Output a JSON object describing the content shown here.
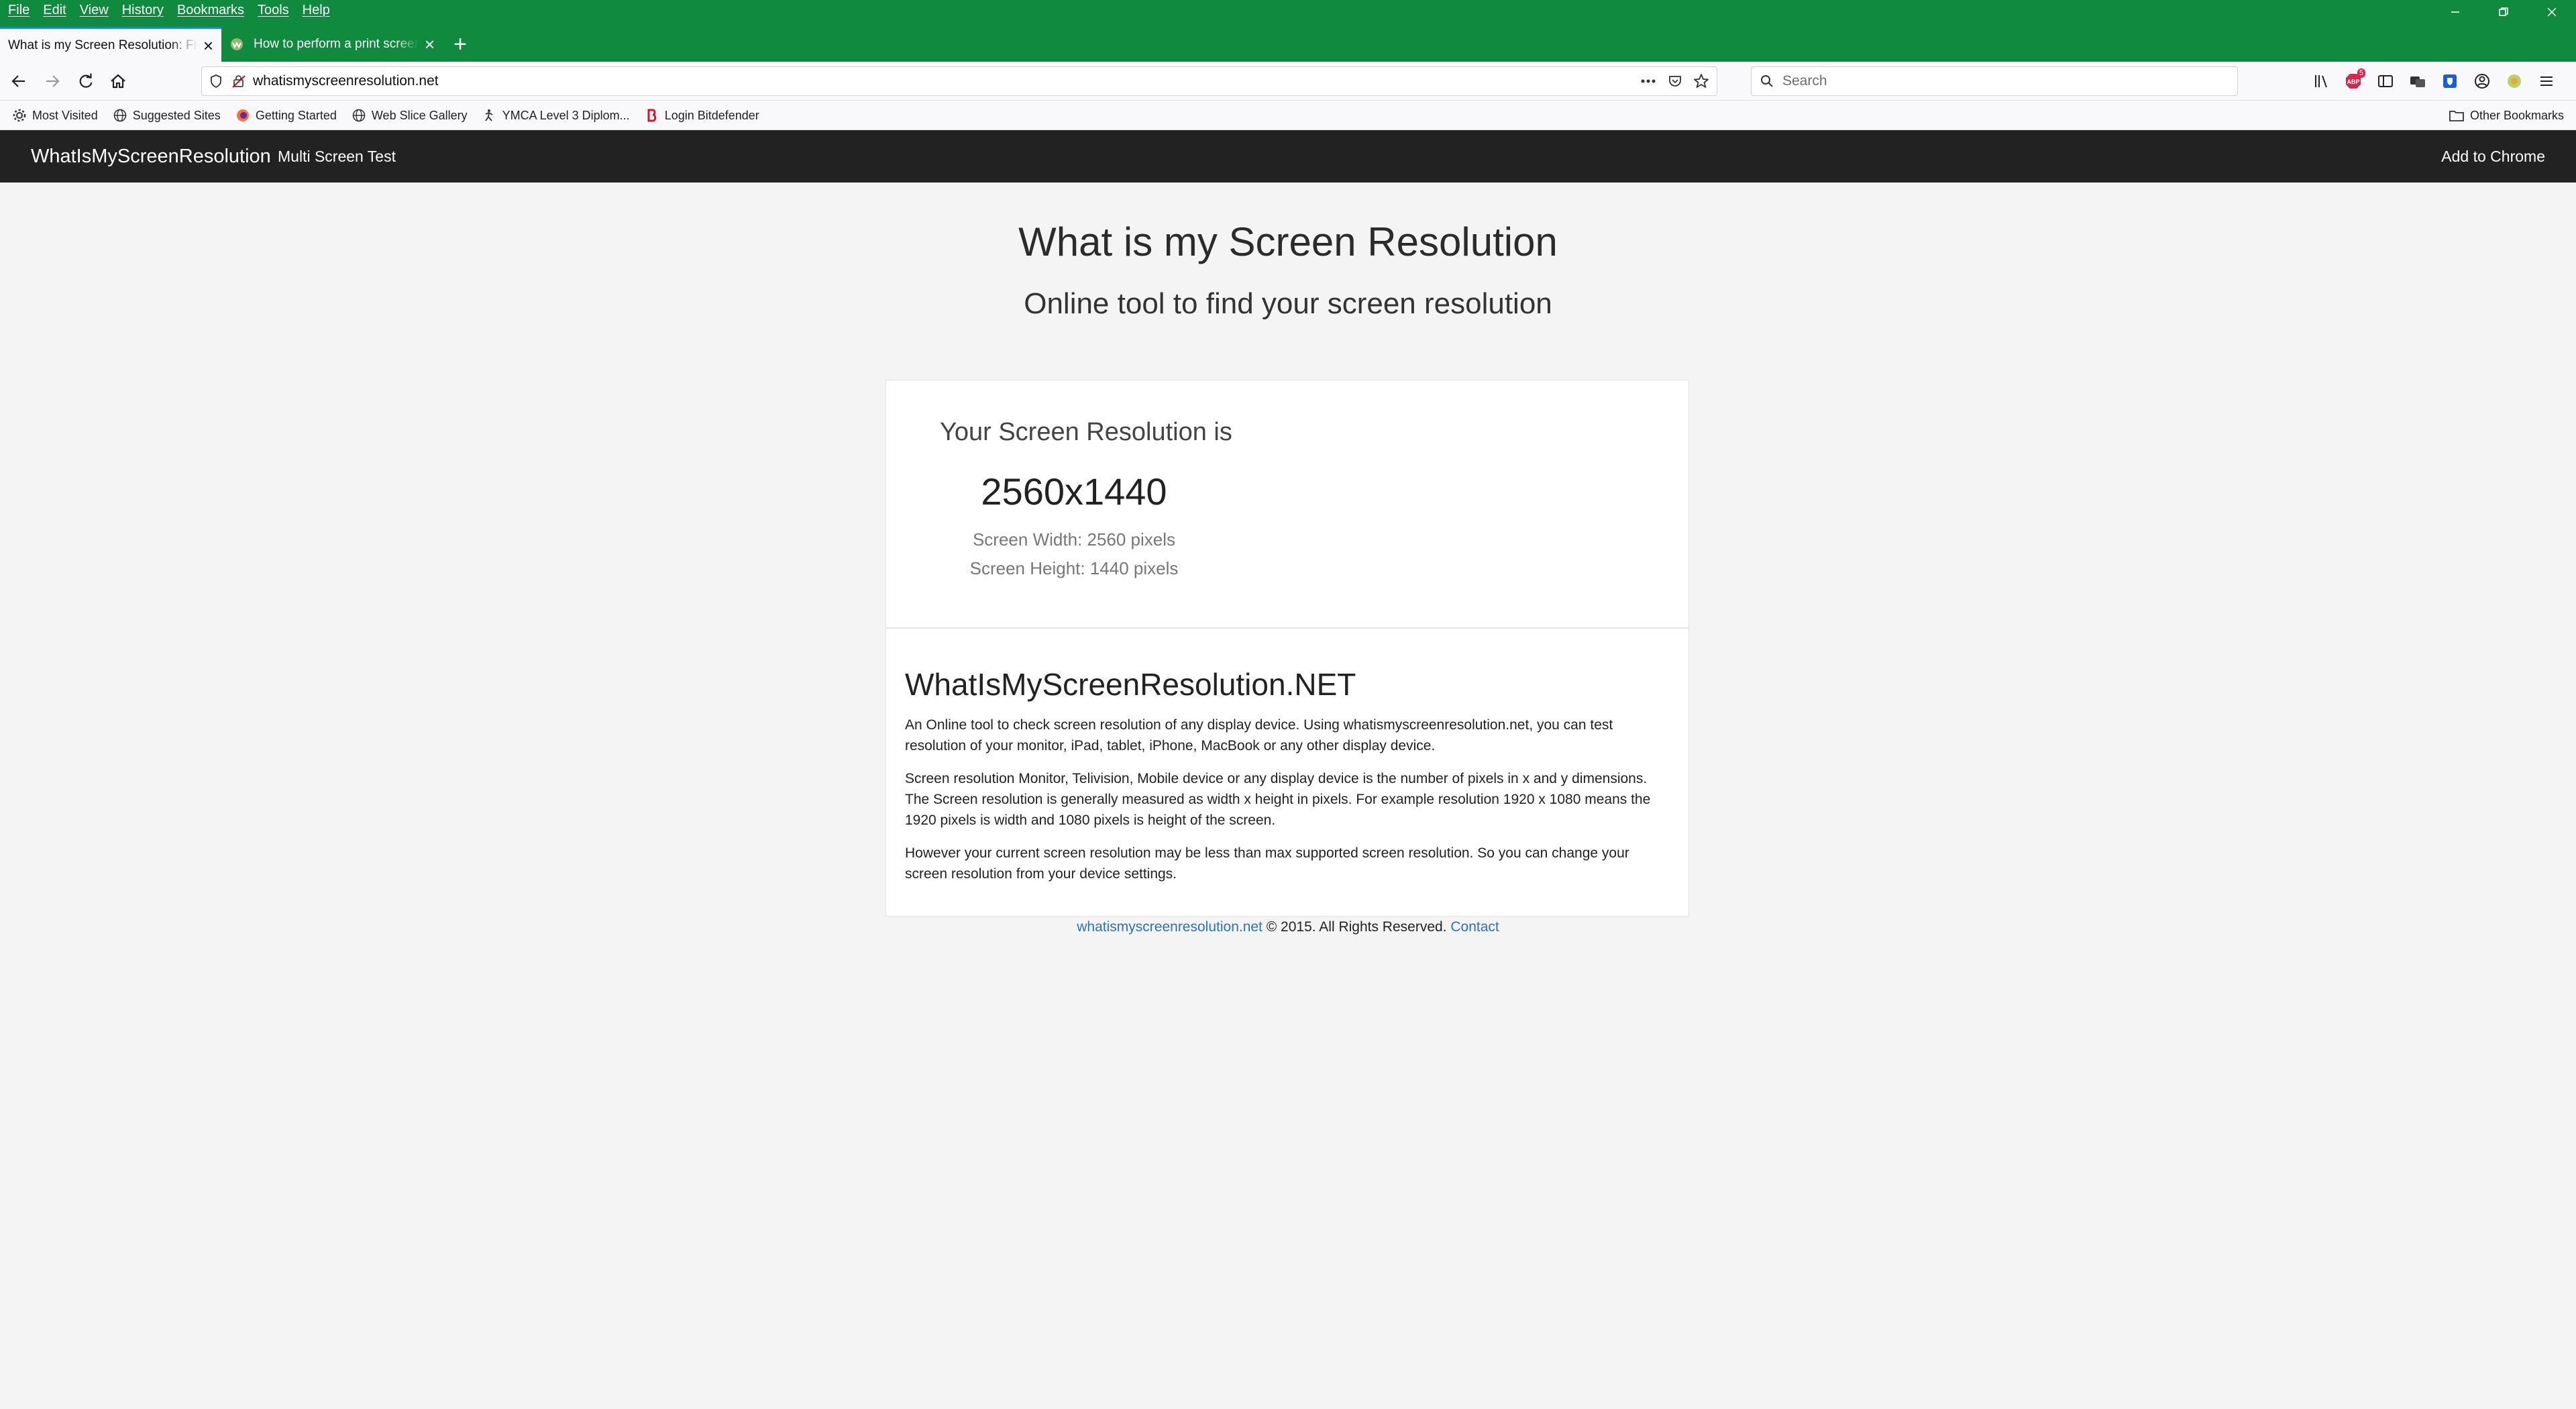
{
  "menu": [
    "File",
    "Edit",
    "View",
    "History",
    "Bookmarks",
    "Tools",
    "Help"
  ],
  "tabs": [
    {
      "title": "What is my Screen Resolution: Find",
      "active": true
    },
    {
      "title": "How to perform a print screen",
      "active": false
    }
  ],
  "address": {
    "url": "whatismyscreenresolution.net"
  },
  "search": {
    "placeholder": "Search"
  },
  "toolbar_icons": [
    "library-icon",
    "adblock-icon",
    "sidebar-icon",
    "extension-icon",
    "bitwarden-icon",
    "account-icon",
    "extension-green-icon",
    "menu-icon"
  ],
  "adblock_badge": "5",
  "bookmarks": [
    {
      "label": "Most Visited",
      "icon": "gear-icon"
    },
    {
      "label": "Suggested Sites",
      "icon": "globe-icon"
    },
    {
      "label": "Getting Started",
      "icon": "firefox-icon"
    },
    {
      "label": "Web Slice Gallery",
      "icon": "globe-icon"
    },
    {
      "label": "YMCA Level 3 Diplom...",
      "icon": "figure-icon"
    },
    {
      "label": "Login Bitdefender",
      "icon": "bitdefender-icon"
    }
  ],
  "other_bookmarks": "Other Bookmarks",
  "site": {
    "brand": "WhatIsMyScreenResolution",
    "nav_link": "Multi Screen Test",
    "nav_right": "Add to Chrome",
    "title": "What is my Screen Resolution",
    "subtitle": "Online tool to find your screen resolution",
    "resolution_label": "Your Screen Resolution is",
    "resolution_value": "2560x1440",
    "width_line": "Screen Width: 2560 pixels",
    "height_line": "Screen Height: 1440 pixels",
    "about_title": "WhatIsMyScreenResolution.NET",
    "paragraphs": [
      "An Online tool to check screen resolution of any display device. Using whatismyscreenresolution.net, you can test resolution of your monitor, iPad, tablet, iPhone, MacBook or any other display device.",
      "Screen resolution Monitor, Telivision, Mobile device or any display device is the number of pixels in x and y dimensions. The Screen resolution is generally measured as width x height in pixels. For example resolution 1920 x 1080 means the 1920 pixels is width and 1080 pixels is height of the screen.",
      "However your current screen resolution may be less than max supported screen resolution. So you can change your screen resolution from your device settings."
    ],
    "footer_link": "whatismyscreenresolution.net",
    "footer_text": " © 2015. All Rights Reserved. ",
    "footer_contact": "Contact"
  },
  "colors": {
    "titlebar": "#0f8a3e",
    "site_nav": "#222222",
    "link": "#2a73c2",
    "page_bg": "#f4f4f4"
  }
}
